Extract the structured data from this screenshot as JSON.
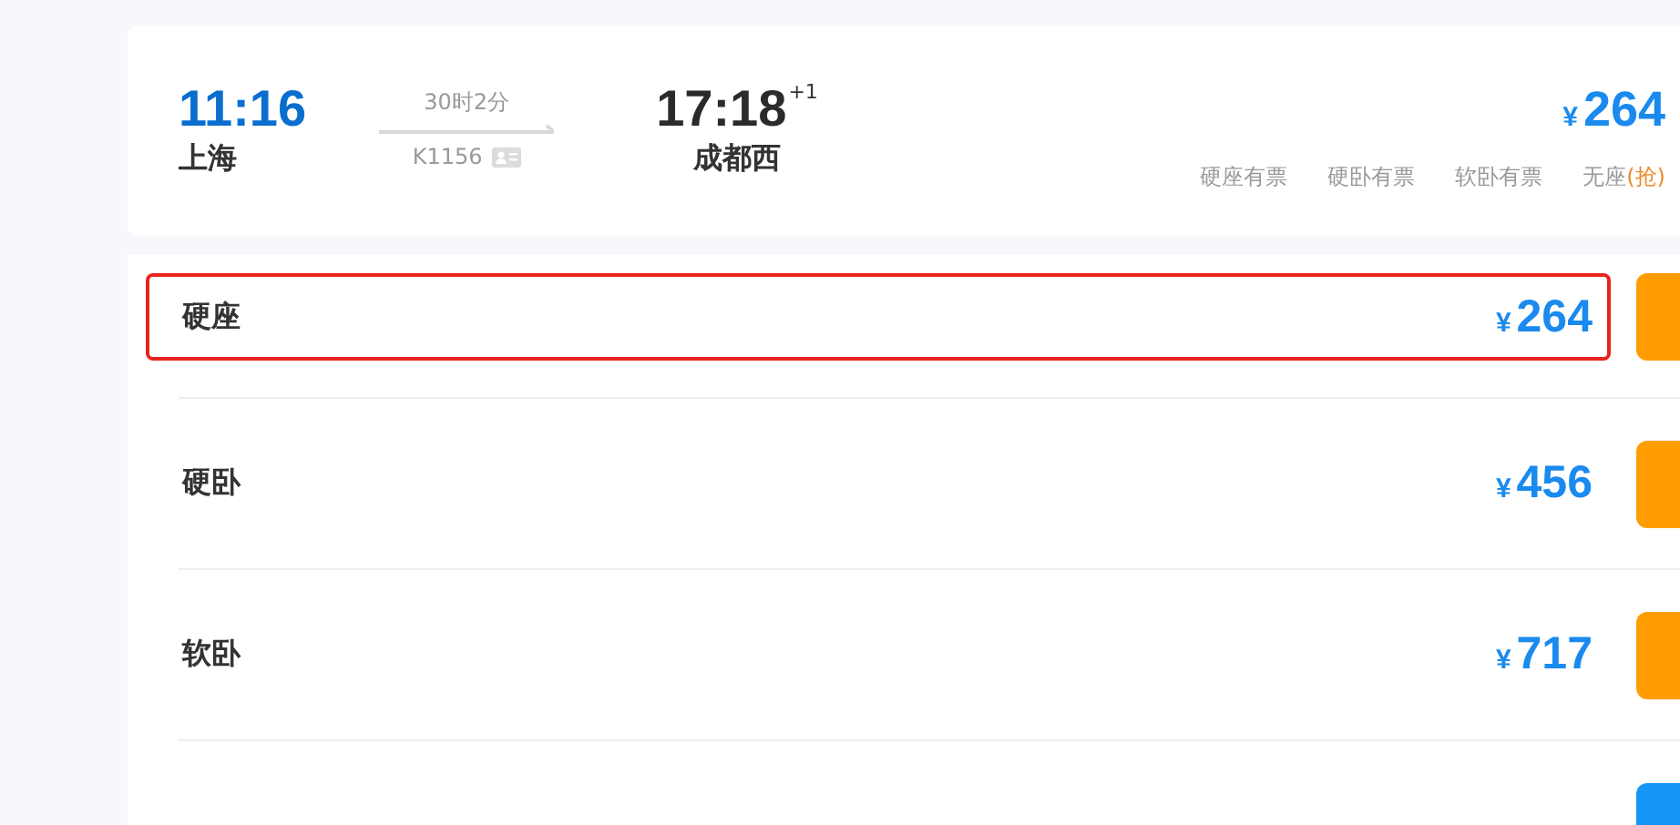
{
  "train": {
    "depart_time": "11:16",
    "depart_station": "上海",
    "duration": "30时2分",
    "number": "K1156",
    "arrive_time": "17:18",
    "day_offset": "+1",
    "arrive_station": "成都西",
    "currency": "¥",
    "lowest_price": "264",
    "availability": [
      {
        "text": "硬座有票"
      },
      {
        "text": "硬卧有票"
      },
      {
        "text": "软卧有票"
      },
      {
        "text": "无座",
        "note": "(抢)"
      }
    ]
  },
  "seats": [
    {
      "name": "硬座",
      "currency": "¥",
      "price": "264",
      "selected": true,
      "color": "#ff9c00"
    },
    {
      "name": "硬卧",
      "currency": "¥",
      "price": "456",
      "selected": false,
      "color": "#ff9c00"
    },
    {
      "name": "软卧",
      "currency": "¥",
      "price": "717",
      "selected": false,
      "color": "#ff9c00"
    },
    {
      "selected": false,
      "color": "#1596f5"
    }
  ]
}
